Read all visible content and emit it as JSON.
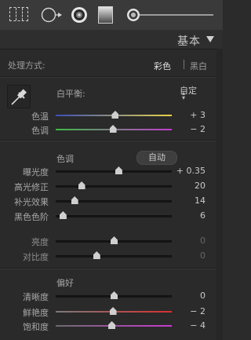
{
  "toolbar": {
    "tools": [
      "crop-overlay-icon",
      "spot-removal-icon",
      "red-eye-icon",
      "graduated-filter-icon",
      "adjustment-brush-icon"
    ]
  },
  "header": {
    "title": "基本"
  },
  "treatment": {
    "label": "处理方式:",
    "color": "彩色",
    "bw": "黑白"
  },
  "white_balance": {
    "label": "白平衡:",
    "value": "自定"
  },
  "wb_sliders": [
    {
      "label": "色温",
      "value": "+ 3",
      "level": 0.51
    },
    {
      "label": "色调",
      "value": "− 2",
      "level": 0.49
    }
  ],
  "tone": {
    "title": "色调",
    "auto_label": "自动"
  },
  "tone_sliders": [
    {
      "label": "曝光度",
      "value": "+ 0.35",
      "level": 0.54
    },
    {
      "label": "高光修正",
      "value": "20",
      "level": 0.22
    },
    {
      "label": "补光效果",
      "value": "14",
      "level": 0.16
    },
    {
      "label": "黑色色阶",
      "value": "6",
      "level": 0.06
    }
  ],
  "contrast_sliders": [
    {
      "label": "亮度",
      "value": "0",
      "level": 0.5
    },
    {
      "label": "对比度",
      "value": "0",
      "level": 0.35
    }
  ],
  "presence": {
    "title": "偏好"
  },
  "presence_sliders": [
    {
      "label": "清晰度",
      "value": "0",
      "level": 0.5
    },
    {
      "label": "鲜艳度",
      "value": "− 2",
      "level": 0.49
    },
    {
      "label": "饱和度",
      "value": "− 4",
      "level": 0.48
    }
  ],
  "colors": {
    "temp_gradient": [
      "#3b4fb6",
      "#e6d34a"
    ],
    "tint_gradient": [
      "#3dbb45",
      "#c23ccd"
    ],
    "vibrance_gradient": [
      "#7a7a7a",
      "#d93030"
    ],
    "saturation_gradient": [
      "#6c6c6c",
      "#c73ad0"
    ]
  }
}
